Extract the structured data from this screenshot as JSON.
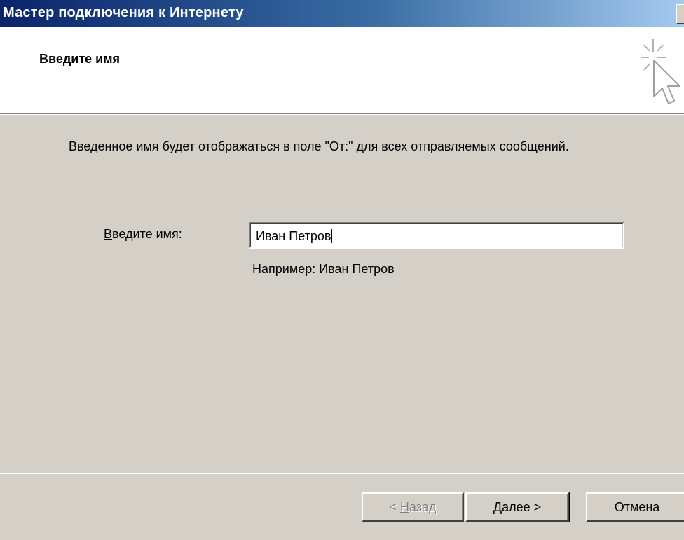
{
  "window": {
    "title": "Мастер подключения к Интернету"
  },
  "header": {
    "title": "Введите имя",
    "icon": "wizard-cursor-sparkle-icon"
  },
  "main": {
    "description": "Введенное имя будет отображаться в поле \"От:\" для всех отправляемых сообщений.",
    "name_field": {
      "label_mnemonic": "В",
      "label_rest": "ведите имя:",
      "value": "Иван Петров"
    },
    "example": "Например: Иван Петров"
  },
  "buttons": {
    "back": {
      "prefix": "< ",
      "mnemonic": "Н",
      "rest": "азад",
      "enabled": false
    },
    "next": {
      "label": "Далее >"
    },
    "cancel": {
      "label": "Отмена"
    }
  },
  "colors": {
    "titlebar_start": "#0a246a",
    "titlebar_end": "#a6caf0",
    "dialog_face": "#d4d0c8",
    "header_bg": "#ffffff"
  }
}
